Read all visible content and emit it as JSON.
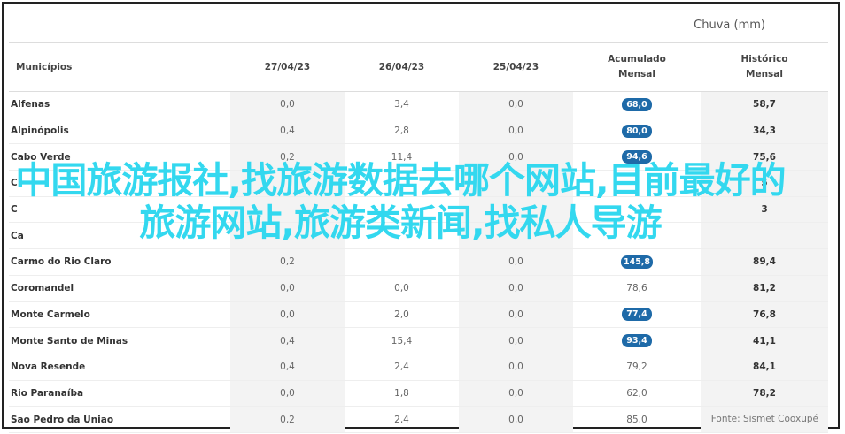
{
  "header": {
    "title": "Chuva (mm)"
  },
  "table": {
    "columns": [
      "Municípios",
      "27/04/23",
      "26/04/23",
      "25/04/23",
      "Acumulado\nMensal",
      "Histórico\nMensal"
    ],
    "rows": [
      {
        "name": "Alfenas",
        "d1": "0,0",
        "d2": "3,4",
        "d3": "0,0",
        "acc": "68,0",
        "acc_badge": true,
        "hist": "58,7"
      },
      {
        "name": "Alpinópolis",
        "d1": "0,4",
        "d2": "2,8",
        "d3": "0,0",
        "acc": "80,0",
        "acc_badge": true,
        "hist": "34,3"
      },
      {
        "name": "Cabo Verde",
        "d1": "0,2",
        "d2": "11,4",
        "d3": "0,0",
        "acc": "94,6",
        "acc_badge": true,
        "hist": "75,6"
      },
      {
        "name": "C",
        "d1": "",
        "d2": "",
        "d3": "",
        "acc": "",
        "acc_badge": false,
        "hist": "5"
      },
      {
        "name": "C",
        "d1": "",
        "d2": "",
        "d3": "",
        "acc": "",
        "acc_badge": false,
        "hist": "3"
      },
      {
        "name": "Ca",
        "d1": "",
        "d2": "",
        "d3": "",
        "acc": "",
        "acc_badge": false,
        "hist": ""
      },
      {
        "name": "Carmo do Rio Claro",
        "d1": "0,2",
        "d2": "",
        "d3": "0,0",
        "acc": "145,8",
        "acc_badge": true,
        "hist": "89,4"
      },
      {
        "name": "Coromandel",
        "d1": "0,0",
        "d2": "0,0",
        "d3": "0,0",
        "acc": "78,6",
        "acc_badge": false,
        "hist": "81,2"
      },
      {
        "name": "Monte Carmelo",
        "d1": "0,0",
        "d2": "2,0",
        "d3": "0,0",
        "acc": "77,4",
        "acc_badge": true,
        "hist": "76,8"
      },
      {
        "name": "Monte Santo de Minas",
        "d1": "0,4",
        "d2": "15,4",
        "d3": "0,0",
        "acc": "93,4",
        "acc_badge": true,
        "hist": "41,1"
      },
      {
        "name": "Nova Resende",
        "d1": "0,4",
        "d2": "2,4",
        "d3": "0,0",
        "acc": "79,2",
        "acc_badge": false,
        "hist": "84,1"
      },
      {
        "name": "Rio Paranaíba",
        "d1": "0,0",
        "d2": "1,8",
        "d3": "0,0",
        "acc": "62,0",
        "acc_badge": false,
        "hist": "78,2"
      },
      {
        "name": "Sao Pedro da Uniao",
        "d1": "0,2",
        "d2": "2,4",
        "d3": "0,0",
        "acc": "85,0",
        "acc_badge": false,
        "hist": ""
      }
    ]
  },
  "source": "Fonte: Sismet Cooxupé",
  "overlay_text": "中国旅游报社,找旅游数据去哪个网站,目前最好的旅游网站,旅游类新闻,找私人导游"
}
